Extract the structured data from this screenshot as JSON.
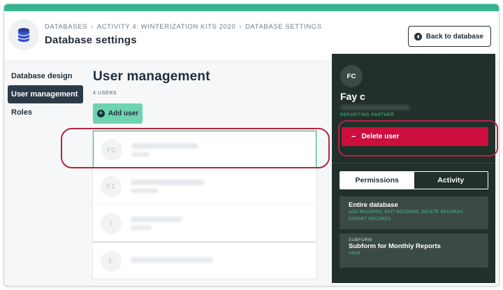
{
  "header": {
    "breadcrumbs": [
      "DATABASES",
      "ACTIVITY 4: WINTERIZATION KITS 2020",
      "DATABASE SETTINGS"
    ],
    "title": "Database settings",
    "back_label": "Back to database"
  },
  "sidebar": {
    "items": [
      {
        "label": "Database design"
      },
      {
        "label": "User management"
      },
      {
        "label": "Roles"
      }
    ]
  },
  "main": {
    "title": "User management",
    "users_count": "4 USERS",
    "add_user_label": "Add user",
    "users": [
      {
        "initials": "FC"
      },
      {
        "initials": "F1"
      },
      {
        "initials": "I"
      },
      {
        "initials": "F"
      }
    ]
  },
  "panel": {
    "initials": "FC",
    "name": "Fay c",
    "role": "REPORTING PARTNER",
    "delete_label": "Delete user",
    "tabs": [
      "Permissions",
      "Activity"
    ],
    "permissions": [
      {
        "subtitle": "",
        "title": "Entire database",
        "rights": "ADD RECORDS, EDIT RECORDS, DELETE RECORDS, EXPORT RECORDS"
      },
      {
        "subtitle": "SUBFORM",
        "title": "Subform for Monthly Reports",
        "rights": "VIEW"
      }
    ]
  },
  "colors": {
    "accent_green": "#33b68f",
    "add_button": "#6fd3b0",
    "delete_red": "#cc0f3e",
    "panel_bg": "#22302b",
    "annotation": "#b4243f"
  },
  "icons": [
    "database-icon",
    "back-arrow-icon",
    "plus-icon",
    "minus-icon"
  ]
}
